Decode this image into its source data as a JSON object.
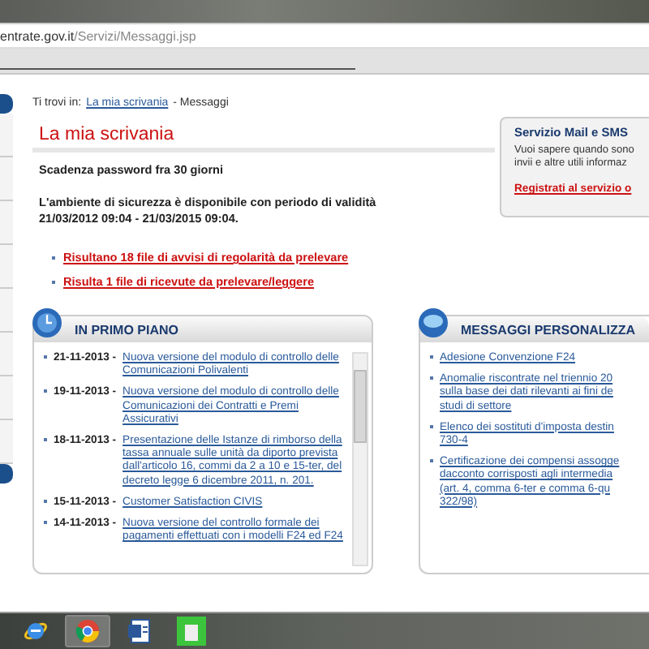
{
  "browser": {
    "address_host": "entrate.gov.it",
    "address_path": "/Servizi/Messaggi.jsp"
  },
  "breadcrumb": {
    "label": "Ti trovi in:",
    "link": "La mia scrivania",
    "current": "- Messaggi"
  },
  "page_title": "La mia scrivania",
  "notices": [
    {
      "lines": [
        "Scadenza password fra 30 giorni"
      ]
    },
    {
      "lines": [
        "L'ambiente di sicurezza è disponibile con periodo di validità",
        "21/03/2012 09:04 - 21/03/2015 09:04."
      ]
    }
  ],
  "file_links": [
    "Risultano 18 file di avvisi di regolarità da prelevare",
    "Risulta 1 file di ricevute da prelevare/leggere"
  ],
  "service_box": {
    "title": "Servizio Mail e SMS",
    "lines": [
      "Vuoi sapere quando sono",
      "invii e altre utili informaz"
    ],
    "link": "Registrati al servizio o"
  },
  "panels": [
    {
      "kind": "news",
      "title": "IN PRIMO PIANO",
      "items": [
        {
          "date": "21-11-2013 -",
          "link": "Nuova versione del modulo di controllo delle Comunicazioni Polivalenti"
        },
        {
          "date": "19-11-2013 -",
          "link": "Nuova versione del modulo di controllo delle Comunicazioni dei Contratti e Premi Assicurativi"
        },
        {
          "date": "18-11-2013 -",
          "link": "Presentazione delle Istanze di rimborso della tassa annuale sulle unità da diporto prevista dall'articolo 16, commi da 2 a 10 e 15-ter, del decreto legge 6 dicembre 2011, n. 201."
        },
        {
          "date": "15-11-2013 -",
          "link": "Customer Satisfaction CIVIS"
        },
        {
          "date": "14-11-2013 -",
          "link": "Nuova versione del controllo formale dei pagamenti effettuati con i modelli F24 ed F24"
        }
      ]
    },
    {
      "kind": "messages",
      "title": "MESSAGGI PERSONALIZZA",
      "items": [
        {
          "lines": [
            "Adesione Convenzione F24"
          ]
        },
        {
          "lines": [
            "Anomalie riscontrate nel triennio 20",
            "sulla base dei dati rilevanti ai fini de",
            "studi di settore"
          ]
        },
        {
          "lines": [
            "Elenco dei sostituti d'imposta destin",
            "730-4"
          ]
        },
        {
          "lines": [
            "Certificazione dei compensi assogge",
            "dacconto corrisposti agli intermedia",
            "(art. 4, comma 6-ter e comma 6-qu",
            "322/98)"
          ]
        }
      ]
    }
  ]
}
